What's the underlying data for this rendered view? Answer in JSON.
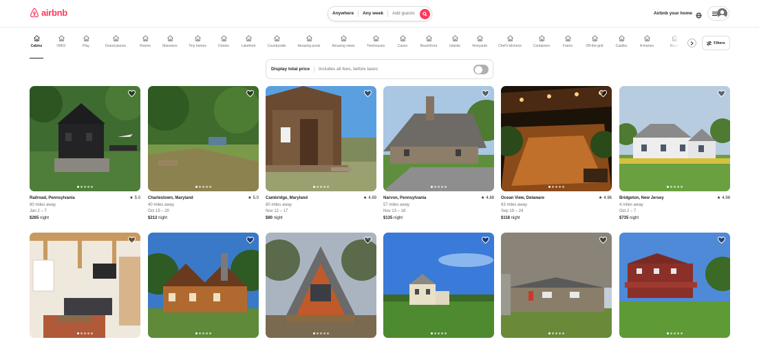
{
  "header": {
    "logo_text": "airbnb",
    "search": {
      "anywhere": "Anywhere",
      "any_week": "Any week",
      "add_guests": "Add guests"
    },
    "host_link": "Airbnb your home",
    "brand_color": "#ff385c"
  },
  "categories": [
    {
      "label": "Cabins",
      "icon": "cabin-icon",
      "active": true
    },
    {
      "label": "OMG!",
      "icon": "ufo-icon"
    },
    {
      "label": "Play",
      "icon": "play-icon"
    },
    {
      "label": "Grand pianos",
      "icon": "piano-icon"
    },
    {
      "label": "Rooms",
      "icon": "bed-icon"
    },
    {
      "label": "Mansions",
      "icon": "mansion-icon"
    },
    {
      "label": "Tiny homes",
      "icon": "tiny-home-icon"
    },
    {
      "label": "Domes",
      "icon": "dome-icon"
    },
    {
      "label": "Lakefront",
      "icon": "lakefront-icon"
    },
    {
      "label": "Countryside",
      "icon": "countryside-icon"
    },
    {
      "label": "Amazing pools",
      "icon": "pool-icon"
    },
    {
      "label": "Amazing views",
      "icon": "views-icon"
    },
    {
      "label": "Treehouses",
      "icon": "treehouse-icon"
    },
    {
      "label": "Caves",
      "icon": "cave-icon"
    },
    {
      "label": "Beachfront",
      "icon": "beach-icon"
    },
    {
      "label": "Islands",
      "icon": "island-icon"
    },
    {
      "label": "Vineyards",
      "icon": "vineyard-icon"
    },
    {
      "label": "Chef's kitchens",
      "icon": "chef-hat-icon"
    },
    {
      "label": "Containers",
      "icon": "container-icon"
    },
    {
      "label": "Farms",
      "icon": "farm-icon"
    },
    {
      "label": "Off-the-grid",
      "icon": "off-grid-icon"
    },
    {
      "label": "Castles",
      "icon": "castle-icon"
    },
    {
      "label": "A-frames",
      "icon": "a-frame-icon"
    },
    {
      "label": "Boats",
      "icon": "boat-icon"
    }
  ],
  "filters_label": "Filters",
  "price_toggle": {
    "label": "Display total price",
    "note": "Includes all fees, before taxes"
  },
  "listings": [
    {
      "location": "Railroad, Pennsylvania",
      "rating": "5.0",
      "distance": "80 miles away",
      "dates": "Jan 2 – 7",
      "price": "$265",
      "unit": "night"
    },
    {
      "location": "Charlestown, Maryland",
      "rating": "5.0",
      "distance": "40 miles away",
      "dates": "Oct 15 – 20",
      "price": "$212",
      "unit": "night"
    },
    {
      "location": "Cambridge, Maryland",
      "rating": "4.89",
      "distance": "80 miles away",
      "dates": "Nov 12 – 17",
      "price": "$80",
      "unit": "night"
    },
    {
      "location": "Narvon, Pennsylvania",
      "rating": "4.88",
      "distance": "57 miles away",
      "dates": "Nov 13 – 18",
      "price": "$135",
      "unit": "night"
    },
    {
      "location": "Ocean View, Delaware",
      "rating": "4.96",
      "distance": "63 miles away",
      "dates": "Sep 19 – 24",
      "price": "$118",
      "unit": "night"
    },
    {
      "location": "Bridgeton, New Jersey",
      "rating": "4.98",
      "distance": "4 miles away",
      "dates": "Oct 2 – 7",
      "price": "$735",
      "unit": "night"
    }
  ]
}
